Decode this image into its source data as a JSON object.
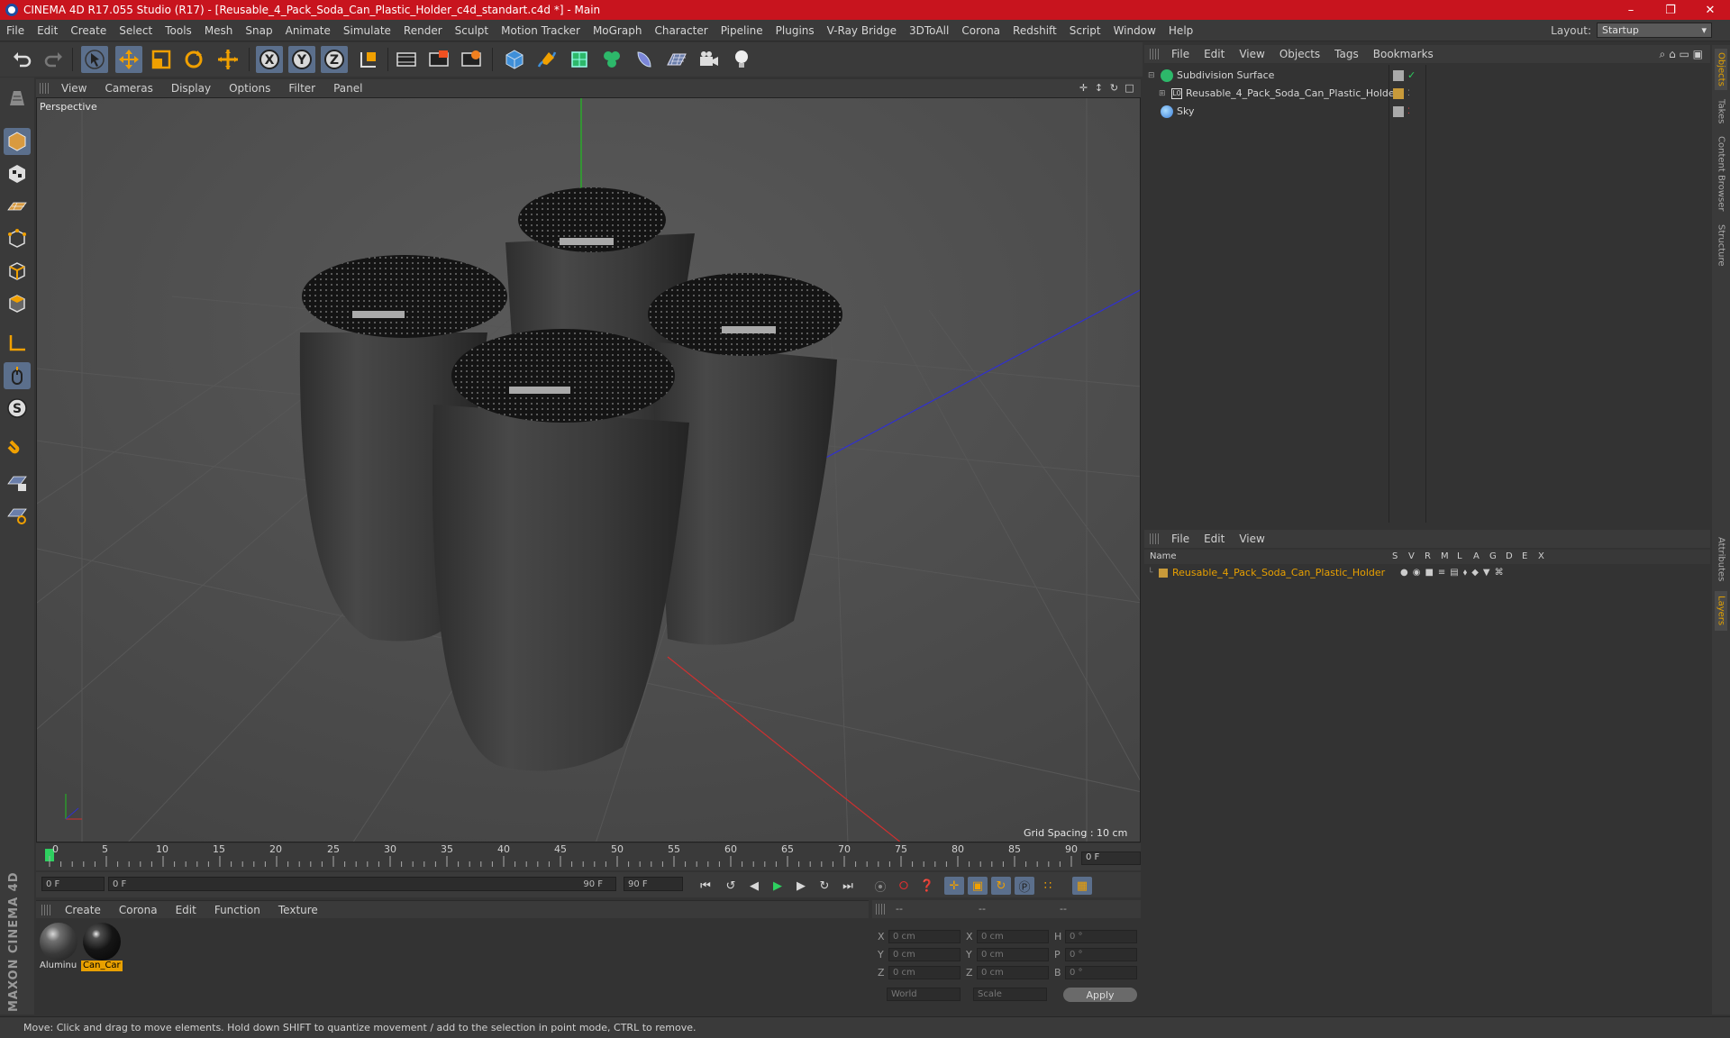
{
  "window": {
    "title": "CINEMA 4D R17.055 Studio (R17) - [Reusable_4_Pack_Soda_Can_Plastic_Holder_c4d_standart.c4d *] - Main",
    "controls": [
      "minimize-icon",
      "restore-icon",
      "close-icon"
    ]
  },
  "menubar": {
    "items": [
      "File",
      "Edit",
      "Create",
      "Select",
      "Tools",
      "Mesh",
      "Snap",
      "Animate",
      "Simulate",
      "Render",
      "Sculpt",
      "Motion Tracker",
      "MoGraph",
      "Character",
      "Pipeline",
      "Plugins",
      "V-Ray Bridge",
      "3DToAll",
      "Corona",
      "Redshift",
      "Script",
      "Window",
      "Help"
    ],
    "layout_label": "Layout:",
    "layout_value": "Startup"
  },
  "toolbar": {
    "icons": [
      "undo-icon",
      "redo-icon",
      "select-arrow-icon",
      "move-icon",
      "scale-icon",
      "rotate-icon",
      "live-selection-icon",
      "x-axis-icon",
      "y-axis-icon",
      "z-axis-icon",
      "coordinate-system-icon",
      "render-view-icon",
      "render-picture-viewer-icon",
      "render-settings-icon",
      "cube-primitive-icon",
      "pen-spline-icon",
      "subdivision-icon",
      "mograph-cloner-icon",
      "deformer-icon",
      "floor-grid-icon",
      "camera-icon",
      "light-icon"
    ]
  },
  "left_tools": {
    "icons": [
      "make-editable-icon",
      "model-mode-icon",
      "texture-mode-icon",
      "workplane-icon",
      "points-mode-icon",
      "edges-mode-icon",
      "polygons-mode-icon",
      "axis-mode-icon",
      "tweak-mode-icon",
      "solo-icon",
      "snap-magnet-icon",
      "lock-workplane-icon",
      "planar-workplane-icon"
    ]
  },
  "viewport": {
    "menu": [
      "View",
      "Cameras",
      "Display",
      "Options",
      "Filter",
      "Panel"
    ],
    "label": "Perspective",
    "grid_spacing": "Grid Spacing : 10 cm"
  },
  "timeline": {
    "ticks": [
      "0",
      "5",
      "10",
      "15",
      "20",
      "25",
      "30",
      "35",
      "40",
      "45",
      "50",
      "55",
      "60",
      "65",
      "70",
      "75",
      "80",
      "85",
      "90"
    ],
    "current_frame": "0 F"
  },
  "transport": {
    "start_field": "0 F",
    "range_start": "0 F",
    "range_end": "90 F",
    "end_field": "90 F"
  },
  "materials": {
    "menu": [
      "Create",
      "Corona",
      "Edit",
      "Function",
      "Texture"
    ],
    "items": [
      {
        "label": "Aluminu",
        "selected": false,
        "color": "#4a4a4a"
      },
      {
        "label": "Can_Car",
        "selected": true,
        "color": "#111111"
      }
    ]
  },
  "coordinates": {
    "header": [
      "--",
      "--",
      "--"
    ],
    "rows": [
      {
        "axis": "X",
        "pos": "0 cm",
        "axis2": "X",
        "size": "0 cm",
        "rot_axis": "H",
        "rot": "0 °"
      },
      {
        "axis": "Y",
        "pos": "0 cm",
        "axis2": "Y",
        "size": "0 cm",
        "rot_axis": "P",
        "rot": "0 °"
      },
      {
        "axis": "Z",
        "pos": "0 cm",
        "axis2": "Z",
        "size": "0 cm",
        "rot_axis": "B",
        "rot": "0 °"
      }
    ],
    "mode": "World",
    "scale": "Scale",
    "apply": "Apply"
  },
  "objects": {
    "menu": [
      "File",
      "Edit",
      "View",
      "Objects",
      "Tags",
      "Bookmarks"
    ],
    "items": [
      {
        "name": "Subdivision Surface",
        "indent": 0,
        "icon": "subdivision-icon"
      },
      {
        "name": "Reusable_4_Pack_Soda_Can_Plastic_Holder",
        "indent": 1,
        "icon": "null-object-icon"
      },
      {
        "name": "Sky",
        "indent": 0,
        "icon": "sky-icon"
      }
    ]
  },
  "layers": {
    "menu": [
      "File",
      "Edit",
      "View"
    ],
    "columns": [
      "Name",
      "S",
      "V",
      "R",
      "M",
      "L",
      "A",
      "G",
      "D",
      "E",
      "X"
    ],
    "items": [
      {
        "name": "Reusable_4_Pack_Soda_Can_Plastic_Holder",
        "color": "#e8a000"
      }
    ]
  },
  "right_tabs": [
    "Objects",
    "Takes",
    "Content Browser",
    "Structure",
    "Attributes",
    "Layers"
  ],
  "status": "Move: Click and drag to move elements. Hold down SHIFT to quantize movement / add to the selection in point mode, CTRL to remove.",
  "colors": {
    "titlebar": "#c8141e",
    "accent": "#e8a000",
    "selected_tool": "#5b6f8c"
  }
}
